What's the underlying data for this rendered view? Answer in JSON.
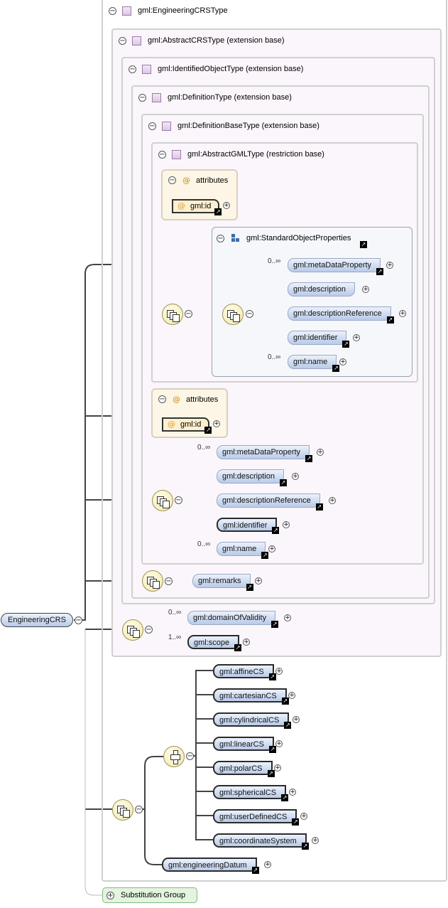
{
  "types": {
    "engineering_crs_type": "gml:EngineeringCRSType",
    "abstract_crs_type": "gml:AbstractCRSType (extension base)",
    "identified_object_type": "gml:IdentifiedObjectType (extension base)",
    "definition_type": "gml:DefinitionType (extension base)",
    "definition_base_type": "gml:DefinitionBaseType (extension base)",
    "abstract_gml_type": "gml:AbstractGMLType (restriction base)"
  },
  "attributes": {
    "title": "attributes",
    "id_label": "gml:id",
    "at_symbol": "@"
  },
  "standard_object_properties": {
    "title": "gml:StandardObjectProperties",
    "items": [
      "gml:metaDataProperty",
      "gml:description",
      "gml:descriptionReference",
      "gml:identifier",
      "gml:name"
    ]
  },
  "definition_elements": [
    "gml:metaDataProperty",
    "gml:description",
    "gml:descriptionReference",
    "gml:identifier",
    "gml:name"
  ],
  "remarks": "gml:remarks",
  "crs_elements": [
    "gml:domainOfValidity",
    "gml:scope"
  ],
  "cs_choices": [
    "gml:affineCS",
    "gml:cartesianCS",
    "gml:cylindricalCS",
    "gml:linearCS",
    "gml:polarCS",
    "gml:sphericalCS",
    "gml:userDefinedCS",
    "gml:coordinateSystem"
  ],
  "engineering_datum": "gml:engineeringDatum",
  "root": "EngineeringCRS",
  "substitution_group": "Substitution Group",
  "cardinality": {
    "zero_unbounded": "0..∞",
    "one_unbounded": "1..∞"
  },
  "icons": {
    "collapse": "⊖",
    "expand": "⊕",
    "link": "↗"
  },
  "colors": {
    "element_fill": "#b8cbe9",
    "attribute_fill": "#fdf6e6",
    "compositor_fill": "#f2e7a8",
    "type_square": "#dcc6e4"
  }
}
